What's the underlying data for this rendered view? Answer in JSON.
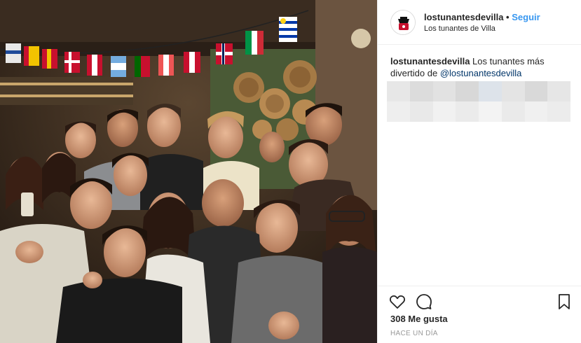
{
  "post": {
    "username": "lostunantesdevilla",
    "separator": "•",
    "follow_label": "Seguir",
    "location": "Los tunantes de Villa",
    "caption": {
      "user": "lostunantesdevilla",
      "text": "Los tunantes más divertido de",
      "mention": "@lostunantesdevilla"
    },
    "likes": "308 Me gusta",
    "timestamp": "HACE UN DÍA"
  },
  "icons": {
    "like": "heart-icon",
    "comment": "comment-icon",
    "save": "bookmark-icon"
  },
  "colors": {
    "link": "#3897f0",
    "mention": "#003569",
    "text": "#262626",
    "muted": "#999999"
  }
}
